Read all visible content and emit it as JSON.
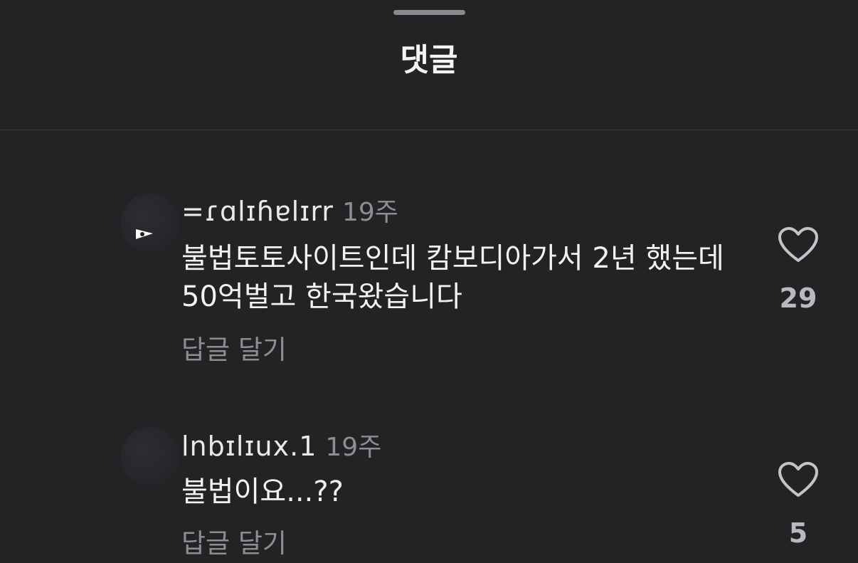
{
  "sheet": {
    "title": "댓글"
  },
  "comments": [
    {
      "username": "=ɾɑlɪɦɐlɪrr",
      "time": "19주",
      "text": "불법토토사이트인데 캄보디아가서 2년 했는데 50억벌고 한국왔습니다",
      "reply_label": "답글 달기",
      "like_count": "29",
      "like_icon": "heart-outline-icon"
    },
    {
      "username": "lnbɪlɪux.1",
      "time": "19주",
      "text": "불법이요...??",
      "reply_label": "답글 달기",
      "like_count": "5",
      "like_icon": "heart-outline-icon"
    }
  ],
  "colors": {
    "background": "#232326",
    "primary_text": "#f2f2f4",
    "secondary_text": "#8d8d92",
    "divider": "#3a3a3e"
  }
}
